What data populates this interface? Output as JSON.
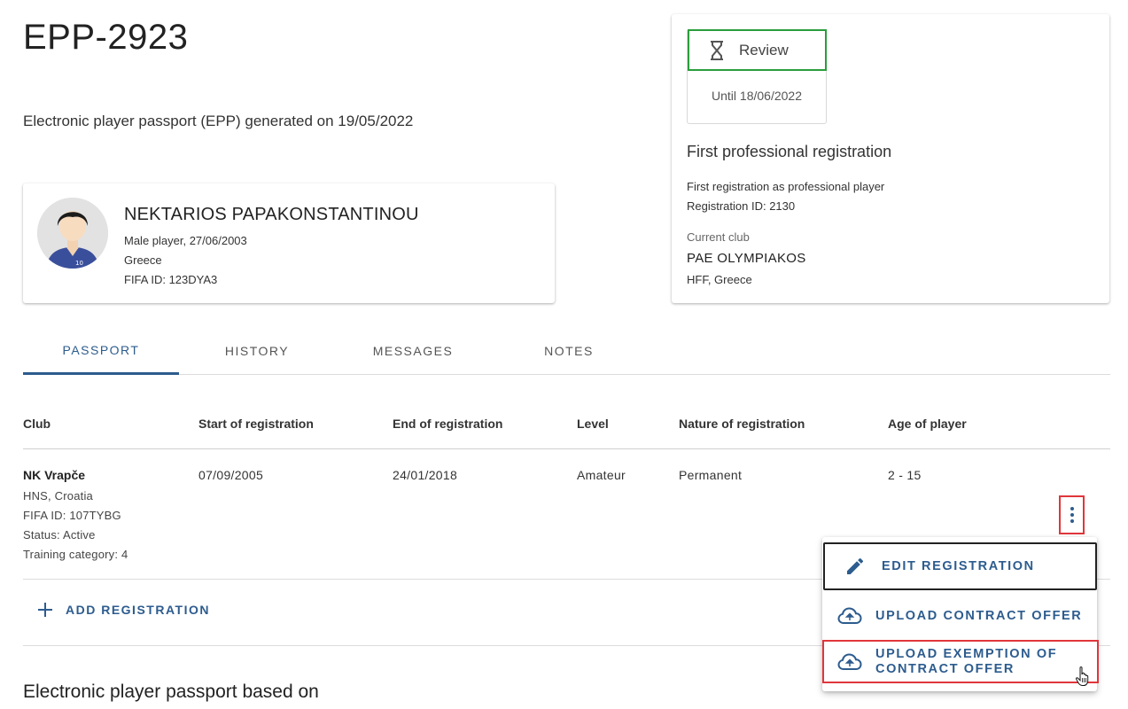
{
  "page": {
    "title": "EPP-2923",
    "subtitle": "Electronic player passport (EPP) generated on 19/05/2022"
  },
  "player": {
    "name": "NEKTARIOS PAPAKONSTANTINOU",
    "gender_dob": "Male player, 27/06/2003",
    "country": "Greece",
    "fifa_id": "FIFA ID: 123DYA3",
    "jersey_number": "10"
  },
  "status": {
    "label": "Review",
    "until": "Until 18/06/2022",
    "registration_title": "First professional registration",
    "registration_desc": "First registration as professional player",
    "registration_id": "Registration ID: 2130",
    "current_club_label": "Current club",
    "current_club": "PAE OLYMPIAKOS",
    "current_club_assoc": "HFF, Greece",
    "pill_border_color": "#2a9d3c"
  },
  "tabs": [
    {
      "label": "PASSPORT",
      "active": true
    },
    {
      "label": "HISTORY",
      "active": false
    },
    {
      "label": "MESSAGES",
      "active": false
    },
    {
      "label": "NOTES",
      "active": false
    }
  ],
  "table": {
    "headers": [
      "Club",
      "Start of registration",
      "End of registration",
      "Level",
      "Nature of registration",
      "Age of player"
    ],
    "rows": [
      {
        "club": "NK Vrapče",
        "club_assoc": "HNS, Croatia",
        "club_fifa_id": "FIFA ID: 107TYBG",
        "club_status": "Status: Active",
        "club_training": "Training category: 4",
        "start": "07/09/2005",
        "end": "24/01/2018",
        "level": "Amateur",
        "nature": "Permanent",
        "age": "2 - 15"
      }
    ]
  },
  "actions": {
    "add_registration": "ADD REGISTRATION",
    "more_icon": "more-vertical-icon"
  },
  "menu": {
    "items": [
      {
        "label": "EDIT REGISTRATION",
        "icon": "pencil-icon"
      },
      {
        "label": "UPLOAD CONTRACT OFFER",
        "icon": "cloud-upload-icon"
      },
      {
        "label": "UPLOAD EXEMPTION OF CONTRACT OFFER",
        "icon": "cloud-upload-icon"
      }
    ]
  },
  "section": {
    "title": "Electronic player passport based on"
  },
  "colors": {
    "accent": "#2d5c8e",
    "highlight": "#e0363b",
    "status_green": "#2a9d3c"
  }
}
